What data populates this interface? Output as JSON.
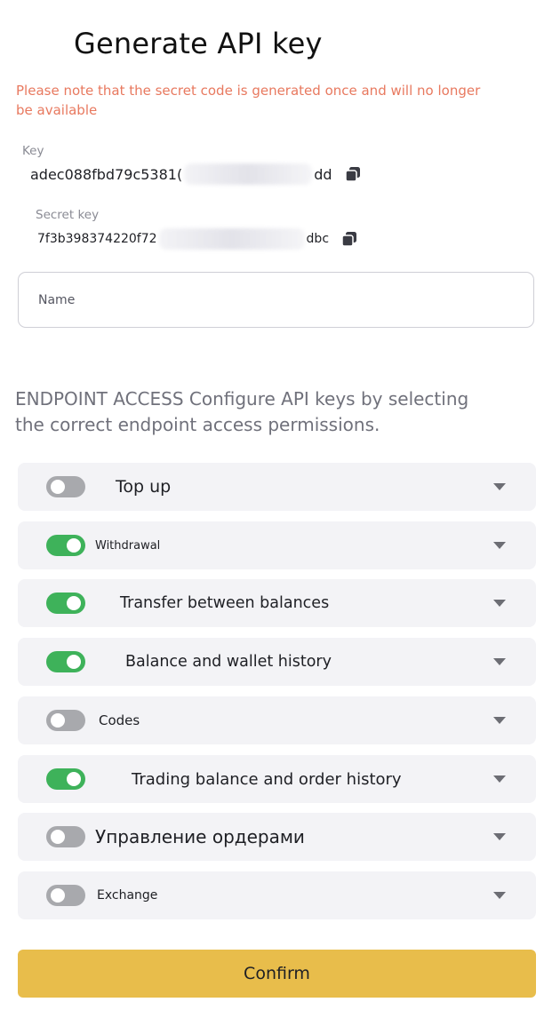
{
  "title": "Generate API key",
  "note": "Please note that the secret code is generated once and will no longer be available",
  "key": {
    "label": "Key",
    "value_start": "adec088fbd79c5381(",
    "value_end": "dd",
    "copy_icon": "copy-icon"
  },
  "secret": {
    "label": "Secret key",
    "value_start": "7f3b398374220f72",
    "value_end": "dbc",
    "copy_icon": "copy-icon"
  },
  "name_field": {
    "placeholder": "Name",
    "value": ""
  },
  "endpoint_access": "ENDPOINT ACCESS Configure API keys by selecting the correct endpoint access permissions.",
  "permissions": [
    {
      "label": "Top up",
      "enabled": false
    },
    {
      "label": "Withdrawal",
      "enabled": true
    },
    {
      "label": "Transfer between balances",
      "enabled": true
    },
    {
      "label": "Balance and wallet history",
      "enabled": true
    },
    {
      "label": "Codes",
      "enabled": false
    },
    {
      "label": "Trading balance and order history",
      "enabled": true
    },
    {
      "label": "Управление ордерами",
      "enabled": false
    },
    {
      "label": "Exchange",
      "enabled": false
    }
  ],
  "colors": {
    "toggle_on": "#3eb25a",
    "toggle_off": "#a8a9ad",
    "confirm_bg": "#e8bd4b",
    "note": "#e8795f"
  },
  "confirm_label": "Confirm"
}
